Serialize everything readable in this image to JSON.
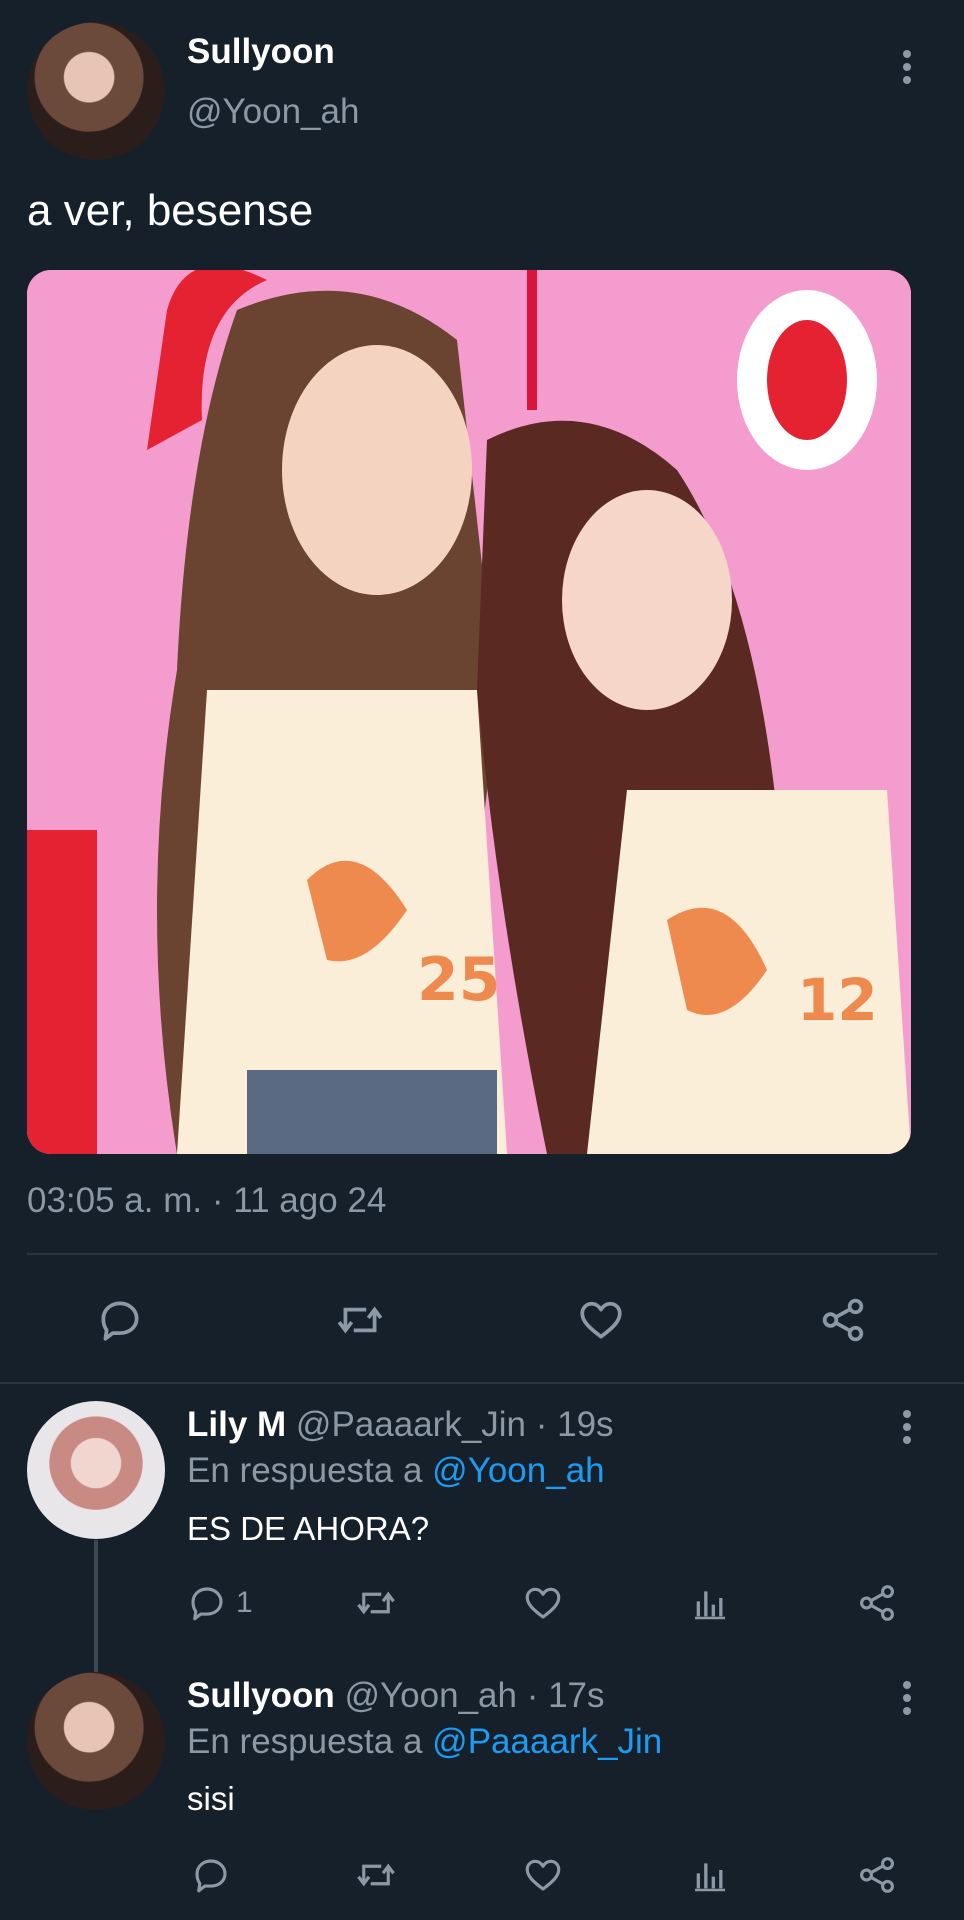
{
  "main_tweet": {
    "display_name": "Sullyoon",
    "handle": "@Yoon_ah",
    "text": "a ver, besense",
    "timestamp": "03:05 a. m. · 11 ago 24"
  },
  "actions": {
    "reply_icon": "reply-icon",
    "retweet_icon": "retweet-icon",
    "like_icon": "heart-icon",
    "share_icon": "share-icon"
  },
  "replies": [
    {
      "display_name": "Lily M",
      "handle_time": "@Paaaark_Jin · 19s",
      "reply_prefix": "En respuesta a",
      "reply_to": "@Yoon_ah",
      "text": "ES DE AHORA?",
      "reply_count": "1"
    },
    {
      "display_name": "Sullyoon",
      "handle_time": "@Yoon_ah · 17s",
      "reply_prefix": "En respuesta a",
      "reply_to": "@Paaaark_Jin",
      "text": "sisi",
      "reply_count": ""
    }
  ],
  "colors": {
    "background": "#16202b",
    "muted": "#8b98a5",
    "link": "#1d9bf0"
  }
}
